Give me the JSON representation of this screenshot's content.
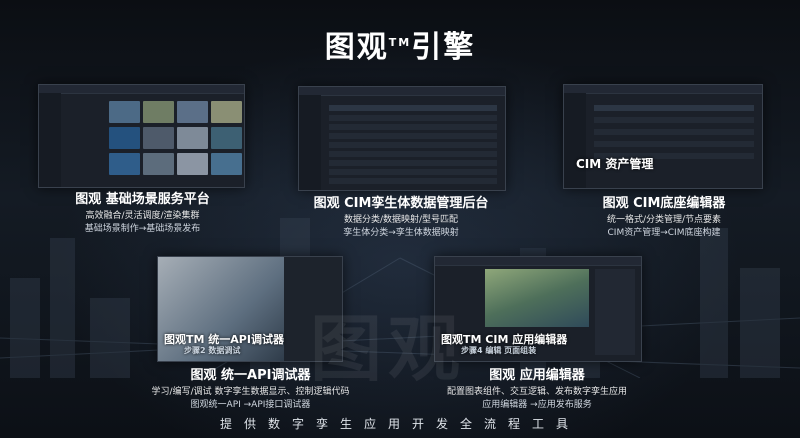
{
  "title": {
    "text": "图观",
    "tm": "TM",
    "suffix": "引擎"
  },
  "cards": {
    "scene": {
      "heading": "图观 基础场景服务平台",
      "sub1": "高效融合/灵活调度/渲染集群",
      "sub2": "基础场景制作→基础场景发布"
    },
    "cim_data": {
      "heading": "图观 CIM孪生体数据管理后台",
      "sub1": "数据分类/数据映射/型号匹配",
      "sub2": "孪生体分类→孪生体数据映射"
    },
    "cim_editor": {
      "heading": "图观 CIM底座编辑器",
      "sub1": "统一格式/分类管理/节点要素",
      "sub2": "CIM资产管理→CIM底座构建",
      "overlay": "CIM 资产管理"
    },
    "api": {
      "heading": "图观 统一API调试器",
      "sub1": "学习/编写/调试 数字孪生数据显示、控制逻辑代码",
      "sub2": "图观统一API →API接口调试器",
      "overlay": "图观TM 统一API调试器",
      "overlay_sub": "步骤2 数据调试"
    },
    "app": {
      "heading": "图观 应用编辑器",
      "sub1": "配置图表组件、交互逻辑、发布数字孪生应用",
      "sub2": "应用编辑器 →应用发布服务",
      "overlay": "图观TM CIM 应用编辑器",
      "overlay_sub": "步骤4 编辑 页面组装"
    }
  },
  "watermark": "图观",
  "footer": "提供数字孪生应用开发全流程工具",
  "colors": {
    "accent": "#2f7de1",
    "bg": "#0d1117"
  }
}
